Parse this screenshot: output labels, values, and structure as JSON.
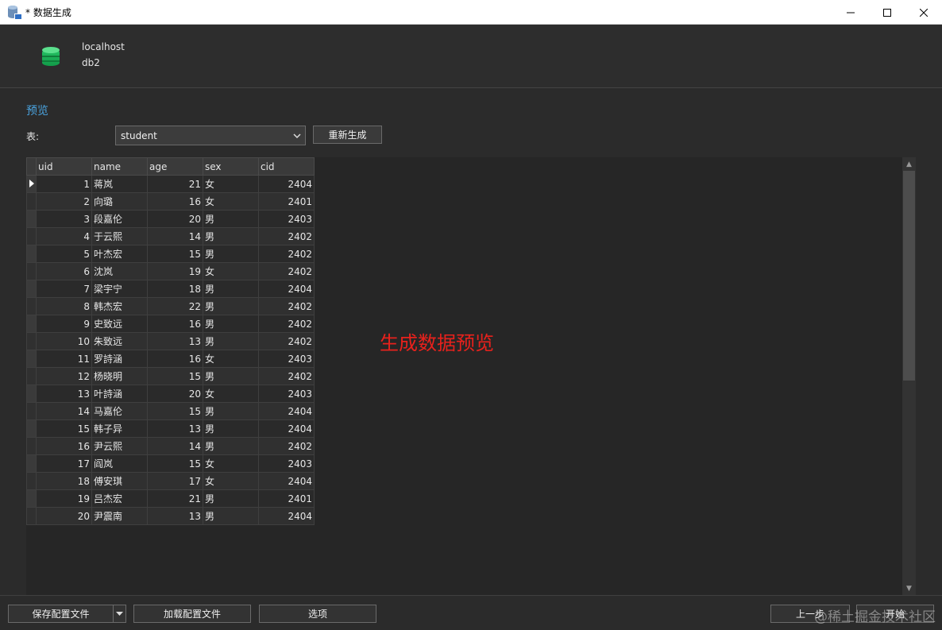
{
  "window": {
    "title": "* 数据生成",
    "controls": {
      "minimize": "─",
      "maximize": "☐",
      "close": "✕"
    }
  },
  "connection": {
    "host": "localhost",
    "database": "db2"
  },
  "preview": {
    "section_title": "预览",
    "table_label": "表:",
    "selected_table": "student",
    "regenerate_label": "重新生成"
  },
  "grid": {
    "columns": [
      "uid",
      "name",
      "age",
      "sex",
      "cid"
    ],
    "rows": [
      [
        "1",
        "蒋岚",
        "21",
        "女",
        "2404"
      ],
      [
        "2",
        "向璐",
        "16",
        "女",
        "2401"
      ],
      [
        "3",
        "段嘉伦",
        "20",
        "男",
        "2403"
      ],
      [
        "4",
        "于云熙",
        "14",
        "男",
        "2402"
      ],
      [
        "5",
        "叶杰宏",
        "15",
        "男",
        "2402"
      ],
      [
        "6",
        "沈岚",
        "19",
        "女",
        "2402"
      ],
      [
        "7",
        "梁宇宁",
        "18",
        "男",
        "2404"
      ],
      [
        "8",
        "韩杰宏",
        "22",
        "男",
        "2402"
      ],
      [
        "9",
        "史致远",
        "16",
        "男",
        "2402"
      ],
      [
        "10",
        "朱致远",
        "13",
        "男",
        "2402"
      ],
      [
        "11",
        "罗詩涵",
        "16",
        "女",
        "2403"
      ],
      [
        "12",
        "杨晓明",
        "15",
        "男",
        "2402"
      ],
      [
        "13",
        "叶詩涵",
        "20",
        "女",
        "2403"
      ],
      [
        "14",
        "马嘉伦",
        "15",
        "男",
        "2404"
      ],
      [
        "15",
        "韩子异",
        "13",
        "男",
        "2404"
      ],
      [
        "16",
        "尹云熙",
        "14",
        "男",
        "2402"
      ],
      [
        "17",
        "阎岚",
        "15",
        "女",
        "2403"
      ],
      [
        "18",
        "傅安琪",
        "17",
        "女",
        "2404"
      ],
      [
        "19",
        "吕杰宏",
        "21",
        "男",
        "2401"
      ],
      [
        "20",
        "尹震南",
        "13",
        "男",
        "2404"
      ]
    ]
  },
  "overlay_annotation": "生成数据预览",
  "footer": {
    "save_config": "保存配置文件",
    "load_config": "加载配置文件",
    "options": "选项",
    "previous": "上一步",
    "start": "开始"
  },
  "watermark": "@稀土掘金技术社区",
  "colors": {
    "accent": "#4aa3df",
    "annotation": "#e8211c",
    "db_icon": "#1fb35a"
  }
}
